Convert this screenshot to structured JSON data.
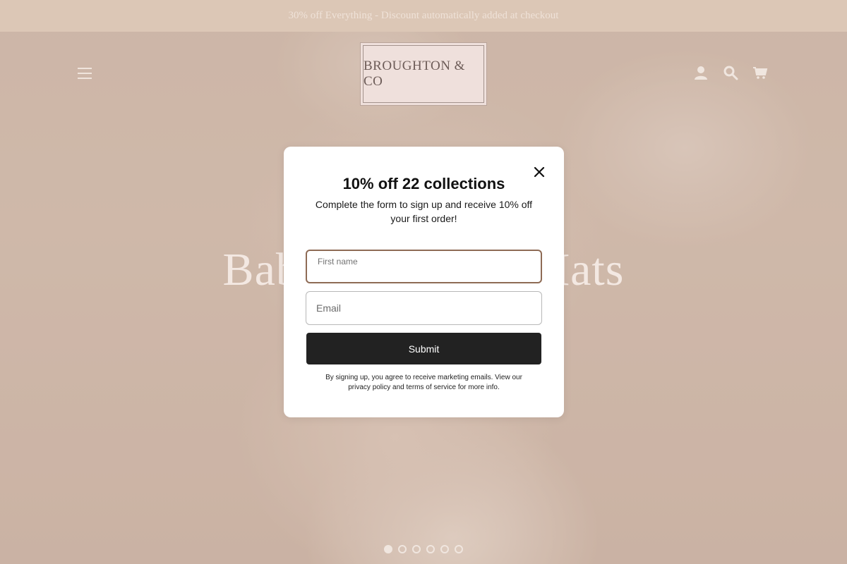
{
  "announcement": {
    "text": "30% off Everything - Discount automatically added at checkout"
  },
  "header": {
    "logo_text": "BROUGHTON & CO",
    "icons": [
      "menu-icon",
      "account-icon",
      "search-icon",
      "cart-icon"
    ]
  },
  "hero": {
    "title": "Baby Pom Pom Hats",
    "slides_total": 6,
    "active_slide": 1
  },
  "modal": {
    "title": "10% off 22 collections",
    "subtitle": "Complete the form to sign up and receive 10% off your first order!",
    "first_name_label": "First name",
    "first_name_value": "",
    "email_placeholder": "Email",
    "submit_label": "Submit",
    "disclaimer": "By signing up, you agree to receive marketing emails. View our privacy policy and terms of service for more info."
  },
  "colors": {
    "accent_border": "#8e6b55",
    "button_bg": "#222222",
    "announcement_bg": "#dcc7b6"
  }
}
